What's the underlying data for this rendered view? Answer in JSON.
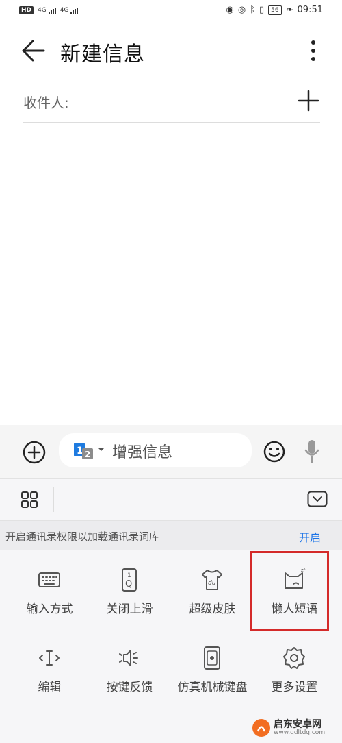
{
  "status_bar": {
    "hd": "HD",
    "sim1": "4G",
    "sim2": "4G",
    "battery": "56",
    "time": "09:51"
  },
  "header": {
    "title": "新建信息",
    "back_icon": "back-arrow-icon",
    "more_icon": "more-vertical-icon"
  },
  "recipient": {
    "label": "收件人:",
    "add_icon": "plus-icon"
  },
  "composer": {
    "placeholder": "增强信息",
    "attach_icon": "add-circle-icon",
    "sim_icon": "dual-sim-icon",
    "emoji_icon": "smiley-icon",
    "mic_icon": "microphone-icon"
  },
  "keyboard": {
    "notice": "开启通讯录权限以加载通讯录词库",
    "notice_action": "开启",
    "tiles": [
      {
        "label": "输入方式",
        "icon": "keyboard-icon"
      },
      {
        "label": "关闭上滑",
        "icon": "swipe-key-icon"
      },
      {
        "label": "超级皮肤",
        "icon": "shirt-icon"
      },
      {
        "label": "懒人短语",
        "icon": "lazy-cat-icon"
      },
      {
        "label": "编辑",
        "icon": "text-cursor-icon"
      },
      {
        "label": "按键反馈",
        "icon": "speaker-icon"
      },
      {
        "label": "仿真机械键盘",
        "icon": "mech-key-icon"
      },
      {
        "label": "更多设置",
        "icon": "gear-icon"
      }
    ]
  },
  "watermark": {
    "name": "启东安卓网",
    "url": "www.qdltdq.com"
  },
  "colors": {
    "accent": "#1a73e8",
    "highlight": "#d42a2a"
  }
}
